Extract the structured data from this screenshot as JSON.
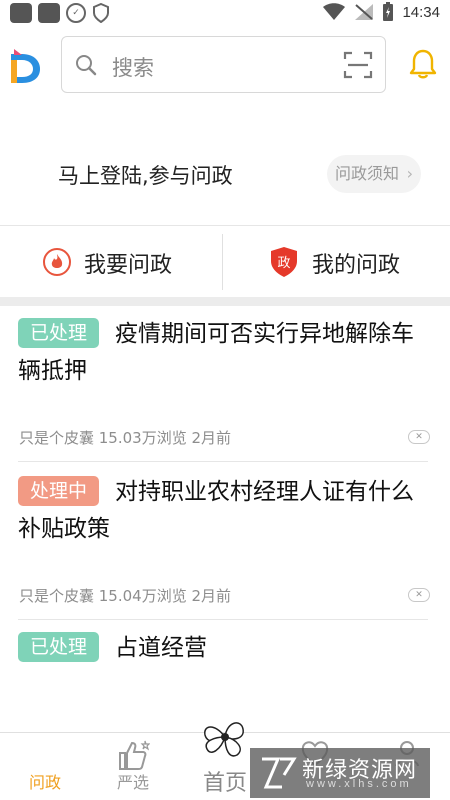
{
  "status_bar": {
    "time": "14:34"
  },
  "search": {
    "placeholder": "搜索"
  },
  "login": {
    "prompt": "马上登陆,参与问政",
    "notice_label": "问政须知",
    "notice_chevron": "›"
  },
  "actions": [
    {
      "label": "我要问政",
      "icon": "fire-icon"
    },
    {
      "label": "我的问政",
      "icon": "shield-icon",
      "icon_text": "政"
    }
  ],
  "feed": [
    {
      "badge": "已处理",
      "status": "done",
      "title": "疫情期间可否实行异地解除车辆抵押",
      "meta": "只是个皮囊 15.03万浏览 2月前"
    },
    {
      "badge": "处理中",
      "status": "doing",
      "title": "对持职业农村经理人证有什么补贴政策",
      "meta": "只是个皮囊 15.04万浏览 2月前"
    },
    {
      "badge": "已处理",
      "status": "done",
      "title": "占道经营"
    }
  ],
  "bottom_nav": [
    {
      "label": "问政",
      "active": true,
      "icon": "megaphone-icon"
    },
    {
      "label": "严选",
      "active": false,
      "icon": "thumbs-up-icon"
    },
    {
      "label": "首页",
      "active": false,
      "icon": "home-flower-icon"
    },
    {
      "label": "",
      "active": false,
      "icon": "heart-icon"
    },
    {
      "label": "",
      "active": false,
      "icon": "user-icon"
    }
  ],
  "watermark": {
    "text": "新绿资源网",
    "sub": "www.xlhs.com"
  },
  "colors": {
    "accent": "#f0a020",
    "done": "#7fd3b8",
    "doing": "#f29a84",
    "separator": "#ececec"
  }
}
